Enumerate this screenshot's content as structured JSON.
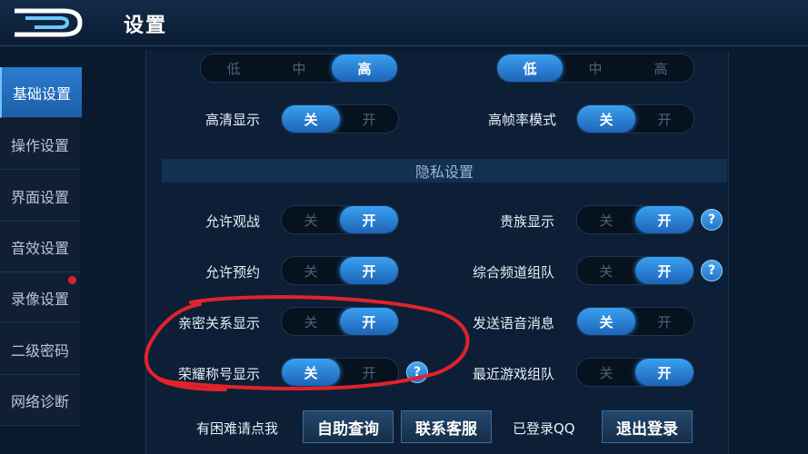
{
  "header": {
    "title": "设置"
  },
  "sidebar": {
    "items": [
      {
        "label": "基础设置"
      },
      {
        "label": "操作设置"
      },
      {
        "label": "界面设置"
      },
      {
        "label": "音效设置"
      },
      {
        "label": "录像设置"
      },
      {
        "label": "二级密码"
      },
      {
        "label": "网络诊断"
      }
    ]
  },
  "quality_row": {
    "left": {
      "options": [
        "低",
        "中",
        "高"
      ],
      "selected": "高"
    },
    "right": {
      "options": [
        "低",
        "中",
        "高"
      ],
      "selected": "低"
    }
  },
  "toggle_labels": {
    "off": "关",
    "on": "开"
  },
  "settings": {
    "hd_display": {
      "label": "高清显示",
      "value": "关"
    },
    "high_fps": {
      "label": "高帧率模式",
      "value": "关"
    }
  },
  "privacy": {
    "section_title": "隐私设置",
    "allow_spectate": {
      "label": "允许观战",
      "value": "开"
    },
    "noble_display": {
      "label": "贵族显示",
      "value": "开"
    },
    "allow_booking": {
      "label": "允许预约",
      "value": "开"
    },
    "channel_team": {
      "label": "综合频道组队",
      "value": "开"
    },
    "intimacy_display": {
      "label": "亲密关系显示",
      "value": "开"
    },
    "send_voice": {
      "label": "发送语音消息",
      "value": "关"
    },
    "honor_title": {
      "label": "荣耀称号显示",
      "value": "关"
    },
    "recent_team": {
      "label": "最近游戏组队",
      "value": "开"
    }
  },
  "footer": {
    "help_text": "有困难请点我",
    "self_query": "自助查询",
    "contact_service": "联系客服",
    "logged_in": "已登录QQ",
    "logout": "退出登录"
  },
  "colors": {
    "accent": "#2a8de0",
    "background": "#0a1a2e",
    "annotation": "#e0232b"
  },
  "icons": {
    "help": "question-mark-icon",
    "logo": "logo-icon"
  }
}
